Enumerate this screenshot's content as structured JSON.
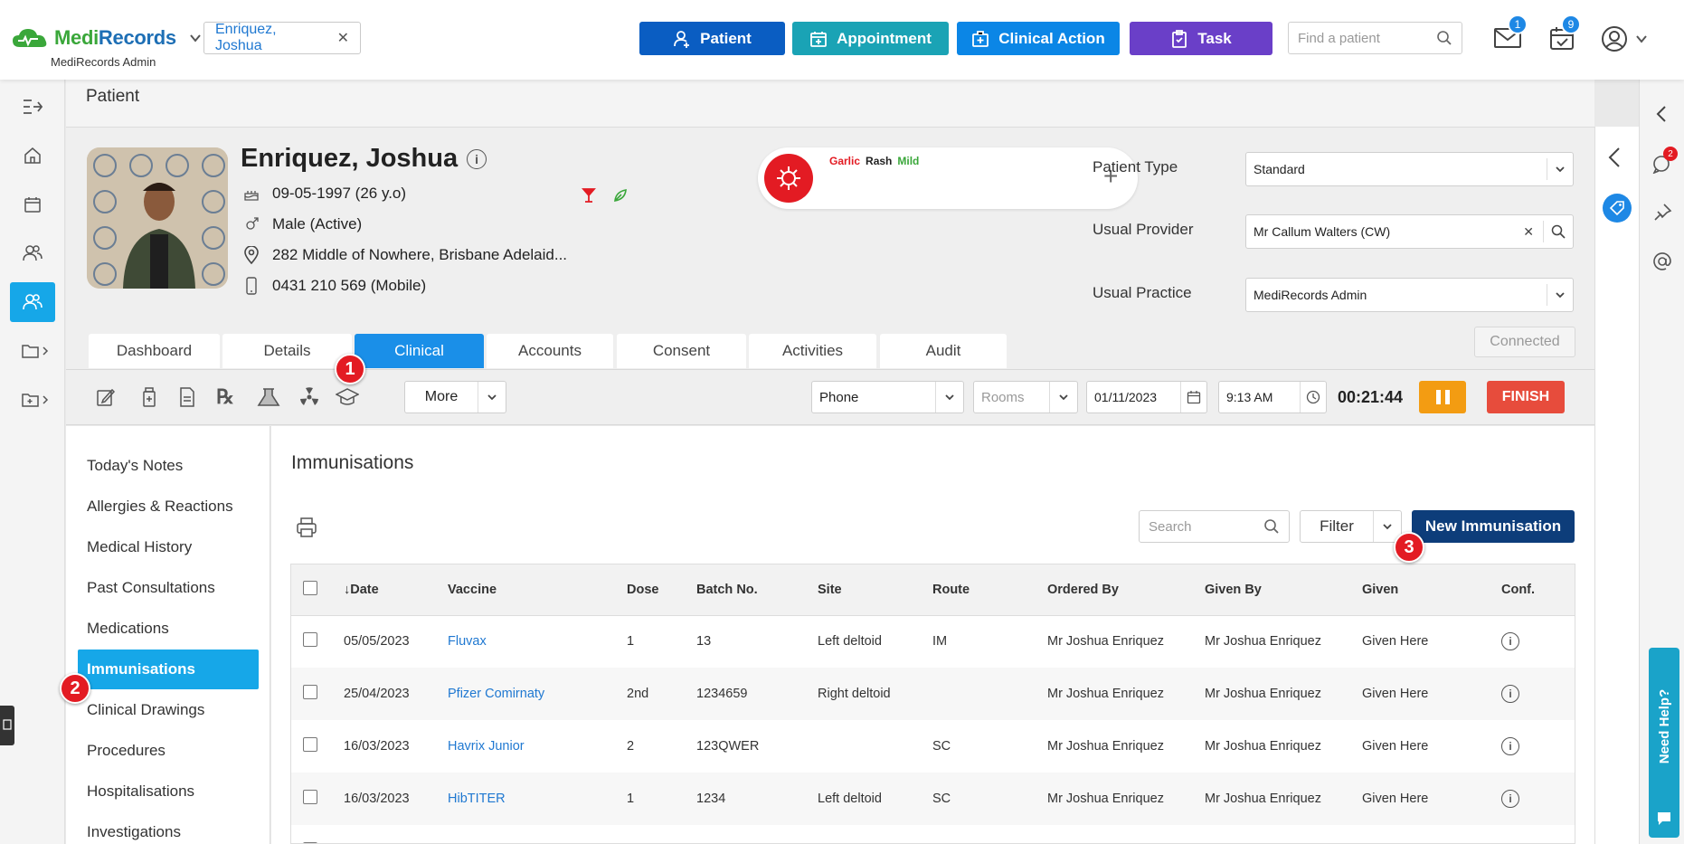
{
  "app": {
    "brand_prefix": "Medi",
    "brand_suffix": "Records",
    "subtitle": "MediRecords Admin"
  },
  "topbar": {
    "patient_tag": "Enriquez, Joshua",
    "buttons": [
      {
        "label": "Patient",
        "color": "#0a5dc2"
      },
      {
        "label": "Appointment",
        "color": "#1aa3b5"
      },
      {
        "label": "Clinical Action",
        "color": "#0b86e6"
      },
      {
        "label": "Task",
        "color": "#6a3fc8"
      }
    ],
    "search_placeholder": "Find a patient",
    "mail_badge": "1",
    "tasks_badge": "9"
  },
  "breadcrumb": "Patient",
  "patient": {
    "name": "Enriquez, Joshua",
    "dob": "09-05-1997 (26 y.o)",
    "gender": "Male (Active)",
    "address": "282 Middle of Nowhere, Brisbane Adelaid...",
    "phone": "0431 210 569 (Mobile)"
  },
  "allergy": {
    "substance": "Garlic",
    "reaction": "Rash",
    "severity": "Mild"
  },
  "fields": {
    "patient_type_label": "Patient Type",
    "patient_type_value": "Standard",
    "usual_provider_label": "Usual Provider",
    "usual_provider_value": "Mr Callum Walters (CW)",
    "usual_practice_label": "Usual Practice",
    "usual_practice_value": "MediRecords Admin",
    "status": "Connected"
  },
  "tabs": [
    "Dashboard",
    "Details",
    "Clinical",
    "Accounts",
    "Consent",
    "Activities",
    "Audit"
  ],
  "toolbar": {
    "more_label": "More",
    "mode": "Phone",
    "rooms_placeholder": "Rooms",
    "date": "01/11/2023",
    "time": "9:13 AM",
    "timer": "00:21:44",
    "finish_label": "FINISH"
  },
  "side_menu": [
    "Today's Notes",
    "Allergies & Reactions",
    "Medical History",
    "Past Consultations",
    "Medications",
    "Immunisations",
    "Clinical Drawings",
    "Procedures",
    "Hospitalisations",
    "Investigations"
  ],
  "immunisations": {
    "title": "Immunisations",
    "search_placeholder": "Search",
    "filter_label": "Filter",
    "new_label": "New Immunisation",
    "columns": [
      "Date",
      "Vaccine",
      "Dose",
      "Batch No.",
      "Site",
      "Route",
      "Ordered By",
      "Given By",
      "Given",
      "Conf."
    ],
    "rows": [
      {
        "date": "05/05/2023",
        "vaccine": "Fluvax",
        "dose": "1",
        "batch": "13",
        "site": "Left deltoid",
        "route": "IM",
        "ordered_by": "Mr Joshua Enriquez",
        "given_by": "Mr Joshua Enriquez",
        "given": "Given Here"
      },
      {
        "date": "25/04/2023",
        "vaccine": "Pfizer Comirnaty",
        "dose": "2nd",
        "batch": "1234659",
        "site": "Right deltoid",
        "route": "",
        "ordered_by": "Mr Joshua Enriquez",
        "given_by": "Mr Joshua Enriquez",
        "given": "Given Here"
      },
      {
        "date": "16/03/2023",
        "vaccine": "Havrix Junior",
        "dose": "2",
        "batch": "123QWER",
        "site": "",
        "route": "SC",
        "ordered_by": "Mr Joshua Enriquez",
        "given_by": "Mr Joshua Enriquez",
        "given": "Given Here"
      },
      {
        "date": "16/03/2023",
        "vaccine": "HibTITER",
        "dose": "1",
        "batch": "1234",
        "site": "Left deltoid",
        "route": "SC",
        "ordered_by": "Mr Joshua Enriquez",
        "given_by": "Mr Joshua Enriquez",
        "given": "Given Here"
      }
    ]
  },
  "markers": [
    "1",
    "2",
    "3"
  ],
  "help_label": "Need Help?",
  "chat_badge": "2"
}
